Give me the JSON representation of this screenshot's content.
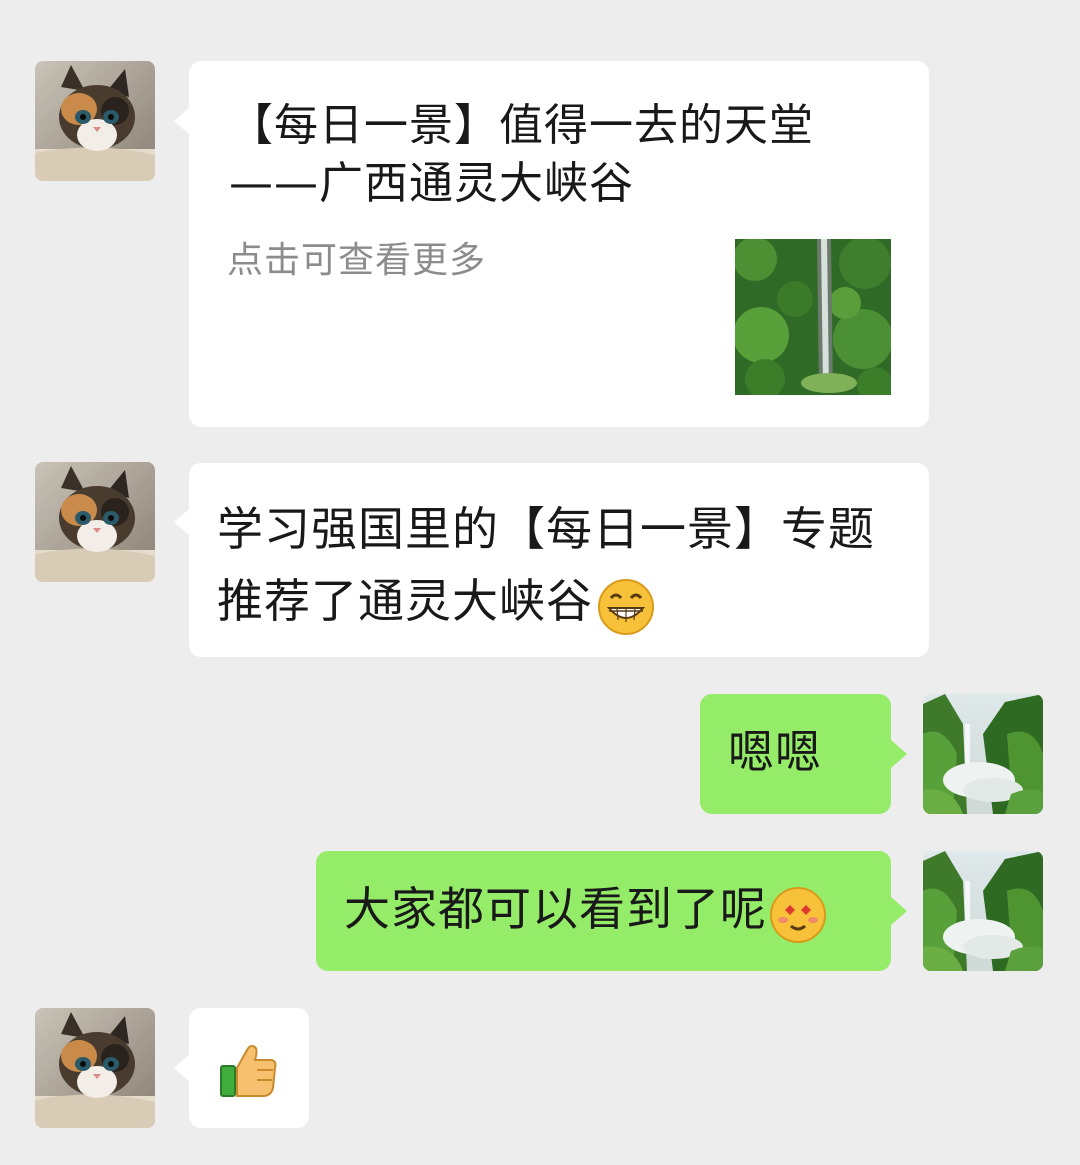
{
  "messages": [
    {
      "sender": "other",
      "type": "link-card",
      "title": "【每日一景】值得一去的天堂——广西通灵大峡谷",
      "description": "点击可查看更多",
      "thumbnail_icon": "waterfall-thumbnail"
    },
    {
      "sender": "other",
      "type": "text",
      "text": "学习强国里的【每日一景】专题推荐了通灵大峡谷",
      "emoji": "grinning-face-emoji"
    },
    {
      "sender": "self",
      "type": "text",
      "text": "嗯嗯"
    },
    {
      "sender": "self",
      "type": "text",
      "text": "大家都可以看到了呢",
      "emoji": "heart-eyes-emoji"
    },
    {
      "sender": "other",
      "type": "sticker",
      "emoji": "thumbs-up-emoji"
    }
  ],
  "avatars": {
    "other": "kitten-avatar",
    "self": "waterfall-landscape-avatar"
  },
  "colors": {
    "background": "#ededed",
    "incoming_bubble": "#ffffff",
    "outgoing_bubble": "#95ec69",
    "text": "#191919",
    "secondary_text": "#8c8c8c"
  }
}
